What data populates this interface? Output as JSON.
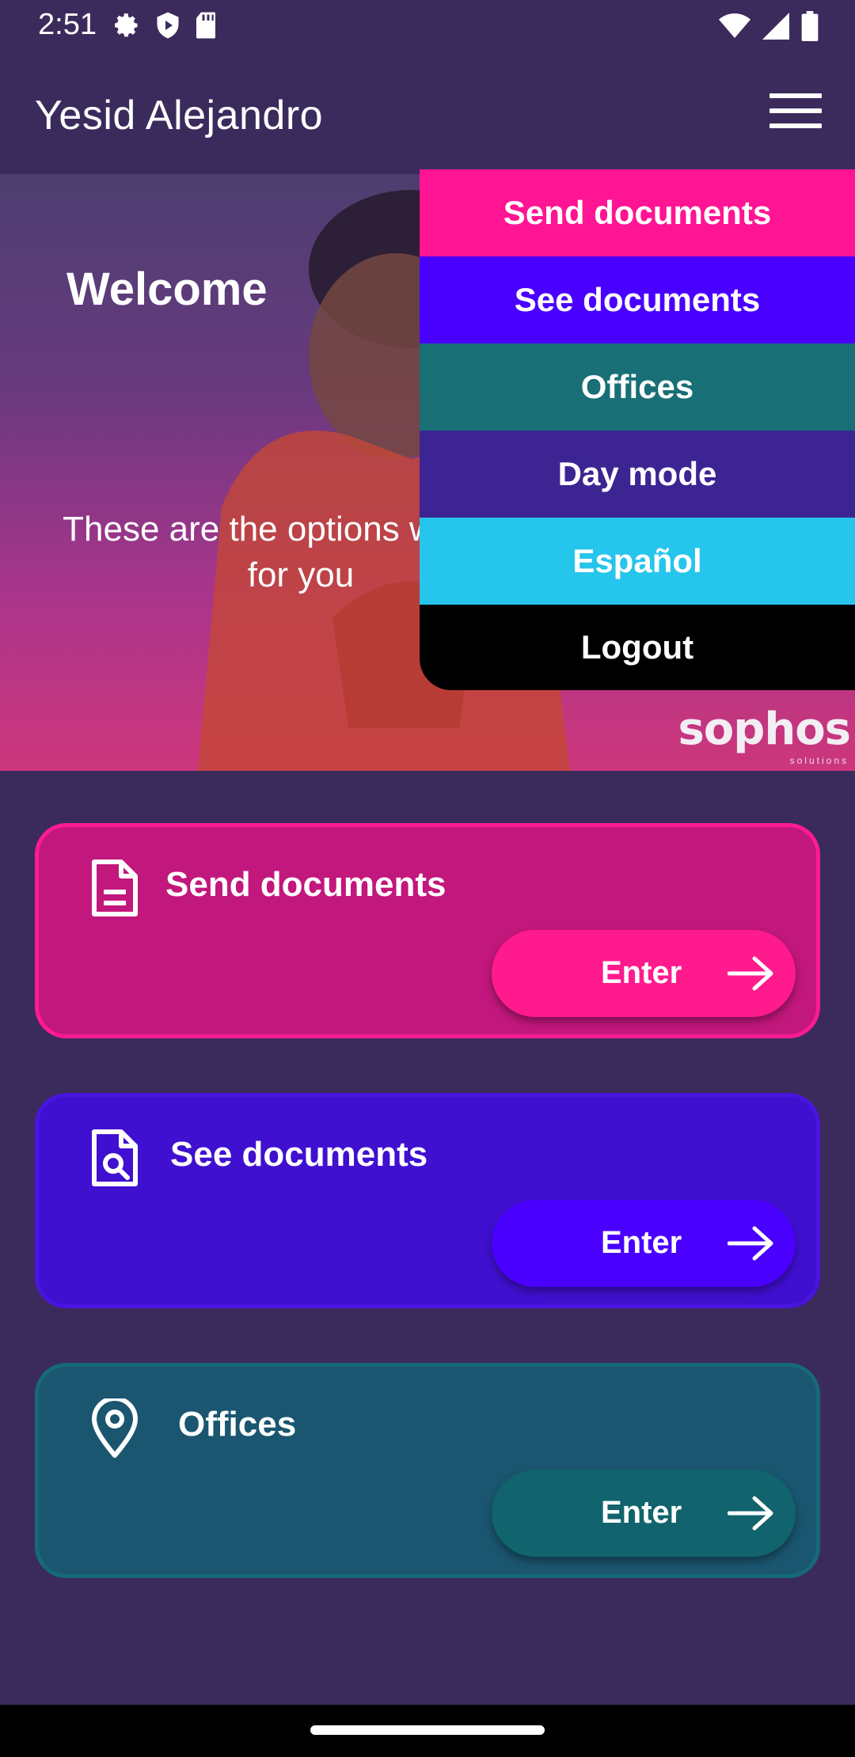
{
  "status": {
    "time": "2:51",
    "icons_left": [
      "gear-icon",
      "shield-icon",
      "sd-card-icon"
    ],
    "icons_right": [
      "wifi-icon",
      "signal-icon",
      "battery-icon"
    ]
  },
  "appbar": {
    "title": "Yesid Alejandro",
    "menu_icon": "hamburger-icon"
  },
  "hero": {
    "welcome": "Welcome",
    "subtitle": "These are the options we have for you",
    "logo": "sophos",
    "logo_sub": "solutions"
  },
  "cards": [
    {
      "title": "Send documents",
      "icon": "document-icon",
      "button": "Enter",
      "color": "#c2177c"
    },
    {
      "title": "See documents",
      "icon": "document-search-icon",
      "button": "Enter",
      "color": "#4010d0"
    },
    {
      "title": "Offices",
      "icon": "location-pin-icon",
      "button": "Enter",
      "color": "#1a5670"
    }
  ],
  "menu": {
    "items": [
      {
        "label": "Send documents",
        "color": "#ff1493"
      },
      {
        "label": "See documents",
        "color": "#4a00ff"
      },
      {
        "label": "Offices",
        "color": "#186f75"
      },
      {
        "label": "Day mode",
        "color": "#3c2592"
      },
      {
        "label": "Español",
        "color": "#26c5eb"
      },
      {
        "label": "Logout",
        "color": "#000000"
      }
    ]
  }
}
